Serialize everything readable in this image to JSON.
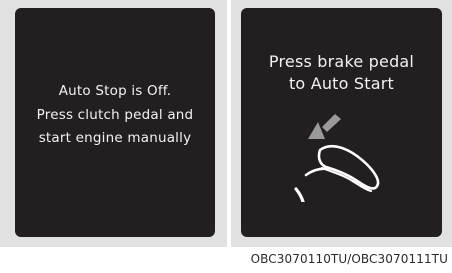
{
  "left_screen": {
    "lines": [
      "Auto Stop is Off.",
      "Press clutch pedal and",
      "start engine manually"
    ]
  },
  "right_screen": {
    "lines": [
      "Press brake pedal",
      "to Auto Start"
    ],
    "illustration": "foot-on-brake-pedal-icon"
  },
  "caption": "OBC3070110TU/OBC3070111TU",
  "colors": {
    "screen_bg": "#231f20",
    "panel_bg": "#e1e1e1",
    "text": "#f2f2f2",
    "arrow": "#9a9a9a"
  }
}
